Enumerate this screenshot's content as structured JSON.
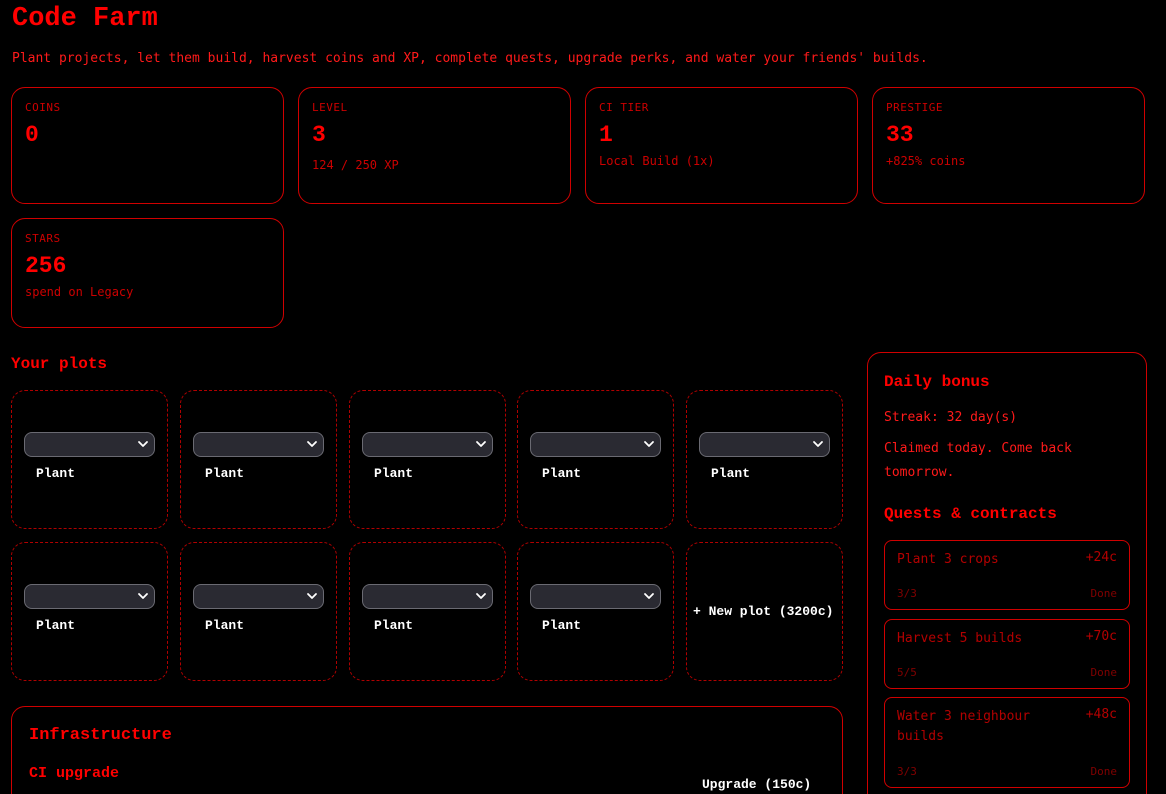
{
  "app": {
    "title": "Code Farm",
    "subtitle": "Plant projects, let them build, harvest coins and XP, complete quests, upgrade perks, and water your friends' builds."
  },
  "stats": [
    {
      "label": "COINS",
      "value": "0",
      "sub": ""
    },
    {
      "label": "LEVEL",
      "value": "3",
      "sub": "124 / 250 XP"
    },
    {
      "label": "CI TIER",
      "value": "1",
      "sub": "Local Build (1x)"
    },
    {
      "label": "PRESTIGE",
      "value": "33",
      "sub": "+825% coins"
    },
    {
      "label": "STARS",
      "value": "256",
      "sub": "spend on Legacy"
    }
  ],
  "plots": {
    "heading": "Your plots",
    "plant_label": "Plant",
    "selected_value": "",
    "new_plot_label": "+ New plot (3200c)"
  },
  "infrastructure": {
    "heading": "Infrastructure",
    "ci_heading": "CI upgrade",
    "upgrade_label": "Upgrade (150c)"
  },
  "daily": {
    "heading": "Daily bonus",
    "streak": "Streak: 32 day(s)",
    "status": "Claimed today. Come back tomorrow."
  },
  "quests": {
    "heading": "Quests & contracts",
    "items": [
      {
        "name": "Plant 3 crops",
        "reward": "+24c",
        "progress": "3/3",
        "status": "Done"
      },
      {
        "name": "Harvest 5 builds",
        "reward": "+70c",
        "progress": "5/5",
        "status": "Done"
      },
      {
        "name": "Water 3 neighbour builds",
        "reward": "+48c",
        "progress": "3/3",
        "status": "Done"
      }
    ]
  },
  "colors": {
    "accent": "#ff0000",
    "background": "#000000",
    "select_bg": "#2a2a32",
    "button_text": "#ffffff"
  }
}
